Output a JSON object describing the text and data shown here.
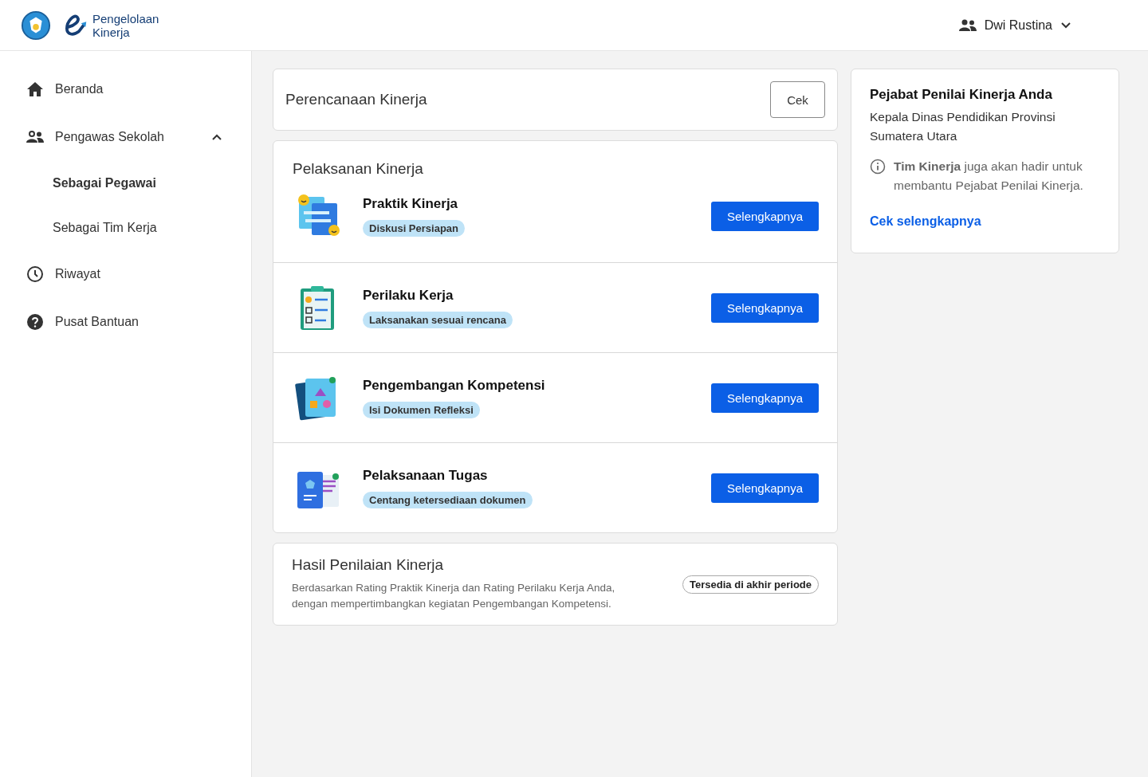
{
  "header": {
    "logo_line_1": "Pengelolaan",
    "logo_line_2": "Kinerja",
    "user_name": "Dwi Rustina"
  },
  "sidebar": {
    "items": [
      {
        "label": "Beranda"
      },
      {
        "label": "Pengawas Sekolah",
        "expanded": true,
        "children": [
          {
            "label": "Sebagai Pegawai",
            "selected": true
          },
          {
            "label": "Sebagai Tim Kerja",
            "selected": false
          }
        ]
      },
      {
        "label": "Riwayat"
      },
      {
        "label": "Pusat Bantuan"
      }
    ]
  },
  "planning": {
    "title": "Perencanaan Kinerja",
    "button": "Cek"
  },
  "execution": {
    "title": "Pelaksanan Kinerja",
    "items": [
      {
        "title": "Praktik Kinerja",
        "status": "Diskusi Persiapan",
        "button": "Selengkapnya"
      },
      {
        "title": "Perilaku Kerja",
        "status": "Laksanakan sesuai rencana",
        "button": "Selengkapnya"
      },
      {
        "title": "Pengembangan Kompetensi",
        "status": "Isi Dokumen Refleksi",
        "button": "Selengkapnya"
      },
      {
        "title": "Pelaksanaan Tugas",
        "status": "Centang ketersediaan dokumen",
        "button": "Selengkapnya"
      }
    ]
  },
  "results": {
    "title": "Hasil Penilaian Kinerja",
    "description": "Berdasarkan Rating Praktik Kinerja dan Rating Perilaku Kerja Anda, dengan mempertimbangkan kegiatan Pengembangan Kompetensi.",
    "badge": "Tersedia di akhir periode"
  },
  "assessor": {
    "title": "Pejabat Penilai Kinerja Anda",
    "name": "Kepala Dinas Pendidikan Provinsi Sumatera Utara",
    "note": "**Tim Kinerja** juga akan hadir untuk membantu Pejabat Penilai Kinerja.",
    "link": "Cek selengkapnya"
  }
}
